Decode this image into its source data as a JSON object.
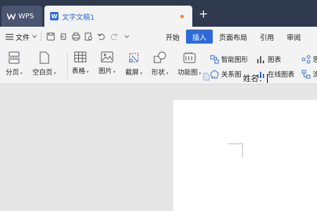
{
  "tabs": {
    "wps_label": "WPS",
    "doc_label": "文字文稿1",
    "new_tab_icon": "plus-icon",
    "unsaved_color": "#f08a2a"
  },
  "menu": {
    "file_label": "文件",
    "tabs": [
      "开始",
      "插入",
      "页面布局",
      "引用",
      "审阅"
    ],
    "active_tab": "插入",
    "accent": "#2e6bd8"
  },
  "ribbon": {
    "page_break": "分页",
    "blank_page": "空白页",
    "table": "表格",
    "picture": "图片",
    "screenshot": "截屏",
    "shapes": "形状",
    "function_chart": "功能图",
    "smart_art": "智能图形",
    "chart": "图表",
    "relation_chart": "关系图",
    "online_chart": "在线图表",
    "cut_off_1": "思",
    "cut_off_2": "流"
  },
  "document": {
    "field_label": "姓名："
  }
}
